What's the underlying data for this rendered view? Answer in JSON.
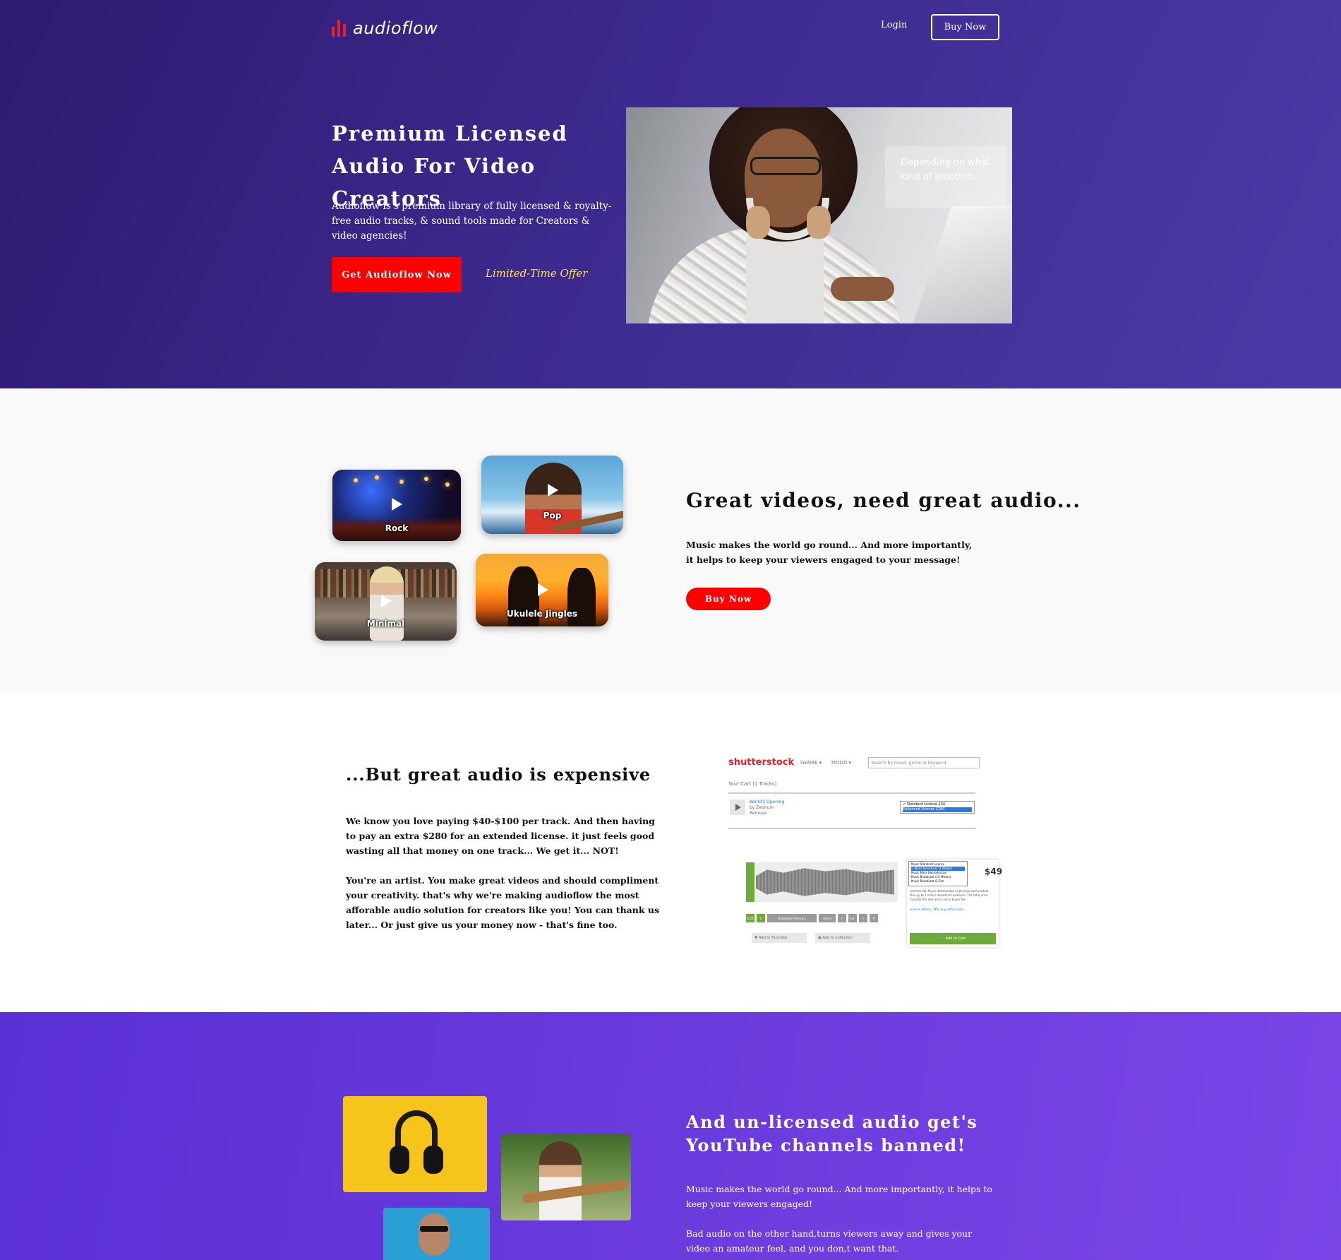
{
  "colors": {
    "hero_bg": "#3d2a8e",
    "cta_red": "#ff0000",
    "offer_yellow": "#ffe14a",
    "section4_bg": "#6a3bdc"
  },
  "header": {
    "logo_text": "audioflow",
    "login_label": "Login",
    "buy_label": "Buy Now"
  },
  "hero": {
    "title": "Premium Licensed Audio For Video Creators",
    "subtitle": "Audioflow is s premium library of fully licensed & royalty-free audio tracks, & sound tools made for Creators & video agencies!",
    "cta_label": "Get Audioflow Now",
    "offer_label": "Limited-Time Offer",
    "overlay_text": "Depending on what kind of emotion..."
  },
  "genres": {
    "rock": "Rock",
    "pop": "Pop",
    "minimal": "Minimal",
    "ukulele": "Ukulele Jingles"
  },
  "section2": {
    "title": "Great videos, need great audio...",
    "text": "Music makes the world go round... And more importantly, it helps to keep your viewers engaged to your message!",
    "button_label": "Buy Now"
  },
  "section3": {
    "title": "...But great audio is expensive",
    "para1": "We know you love paying $40-$100 per track. And then having to pay an extra $280 for an extended license. it just feels good wasting all that money on one track... We get it... NOT!",
    "para2": "You're an artist. You make great videos and should compliment your creativity. that's why we're making audioflow the most afforable audio solution for creators like you! You can thank us later... Or just give us your money now - that's fine too."
  },
  "screenshot1": {
    "brand": "shutterstock",
    "genre": "GENRE ▾",
    "mood": "MOOD ▾",
    "search_placeholder": "Search by mood, genre or keyword",
    "cart": "Your Cart (1 Tracks)",
    "track": "World's Opening",
    "by": "by Zeonum",
    "remove": "Remove",
    "opt1": "✓ Standard License £34",
    "opt2": "Enhanced License £280"
  },
  "screenshot2": {
    "time": "0:26",
    "preview": "Download Preview ⤓",
    "share": "Share",
    "favorites": "♥ Add to Favorites",
    "collection": "▣ Add to Collection",
    "price": "$49",
    "drop1": "Music Standard License",
    "drop2": "✓ Music Broadcast (1 Million)",
    "drop3": "Music Mass Reproduction",
    "drop4": "Music Broadcast (10 Million)",
    "drop5": "Music Broadcast & Film",
    "panel_text": "commercial. Music downloaded or physical and product. Plus up to 1 million broadcast audience. The total price includes the item price and a buyer fee.",
    "license_link": "License details | Why buy with Envato",
    "add_cart": "🛒 Add to Cart"
  },
  "section4": {
    "title": "And un-licensed audio get's YouTube channels banned!",
    "para1": "Music makes the world go round... And more importantly, it helps to keep your viewers engaged!",
    "para2": "Bad audio on the other hand,turns viewers away and gives your video an amateur feel, and you don,t want that."
  }
}
